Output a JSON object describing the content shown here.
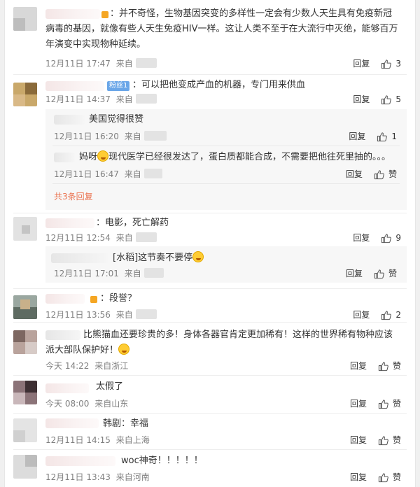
{
  "colors": {
    "accent": "#eb7350",
    "meta": "#808080",
    "subbg": "#f7f7f7"
  },
  "labels": {
    "reply": "回复",
    "like": "赞"
  },
  "comments": [
    {
      "text": "：并不奇怪，生物基因突变的多样性一定会有少数人天生具有免疫新冠病毒的基因，就像有些人天生免疫HIV一样。这让人类不至于在大流行中灭绝，能够百万年演变中实现物种延续。",
      "date": "12月11日 17:47",
      "src": "来自",
      "likes": "3"
    },
    {
      "text": "：可以把他变成产血的机器，专门用来供血",
      "date": "12月11日 14:37",
      "src": "来自",
      "likes": "5",
      "fanbadge": "粉丝1",
      "subs": [
        {
          "text": "美国觉得很赞",
          "date": "12月11日 16:20",
          "src": "来自",
          "likes": "1"
        },
        {
          "text_a": "妈呀",
          "text_b": "现代医学已经很发达了，蛋白质都能合成，不需要把他往死里抽的。。。",
          "date": "12月11日 16:47",
          "src": "来自",
          "likes": "赞"
        }
      ],
      "more": "共3条回复"
    },
    {
      "text": "：电影，死亡解药",
      "date": "12月11日 12:54",
      "src": "来自",
      "likes": "9",
      "subs": [
        {
          "text": "[水稻]这节奏不要停",
          "date": "12月11日 17:01",
          "src": "来自",
          "likes": "赞"
        }
      ]
    },
    {
      "text": "：段誉？",
      "date": "12月11日 13:56",
      "src": "来自",
      "likes": "2"
    },
    {
      "text": "比熊猫血还要珍贵的多！身体各器官肯定更加稀有！这样的世界稀有物种应该派大部队保护好！",
      "date": "今天 14:22",
      "src": "来自浙江",
      "likes": "赞"
    },
    {
      "text": "太假了",
      "date": "今天 08:00",
      "src": "来自山东",
      "likes": "赞"
    },
    {
      "text": "韩剧：幸福",
      "date": "12月11日 14:15",
      "src": "来自上海",
      "likes": "赞"
    },
    {
      "text": "woc神奇！！！！！",
      "date": "12月11日 13:43",
      "src": "来自河南",
      "likes": "赞"
    }
  ]
}
